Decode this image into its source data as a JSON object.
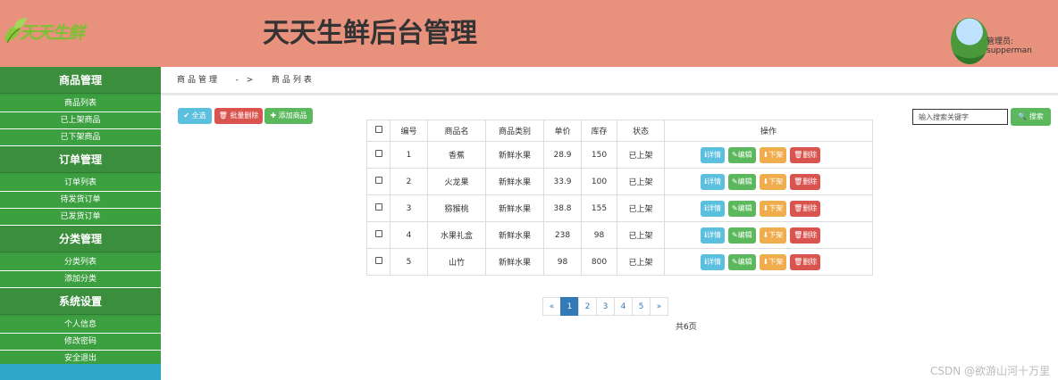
{
  "header": {
    "logo_text": "天天生鲜",
    "title": "天天生鲜后台管理",
    "admin_label": "管理员: supperman"
  },
  "sidebar": {
    "groups": [
      {
        "title": "商品管理",
        "items": [
          "商品列表",
          "已上架商品",
          "已下架商品"
        ]
      },
      {
        "title": "订单管理",
        "items": [
          "订单列表",
          "待发货订单",
          "已发货订单"
        ]
      },
      {
        "title": "分类管理",
        "items": [
          "分类列表",
          "添加分类"
        ]
      },
      {
        "title": "系统设置",
        "items": [
          "个人信息",
          "修改密码",
          "安全退出"
        ]
      }
    ]
  },
  "breadcrumb": {
    "section": "商品管理",
    "sep": "- >",
    "page": "商品列表"
  },
  "toolbar": {
    "select_all": "✔ 全选",
    "batch_delete": "🗑 批量删除",
    "add_product": "✚ 添加商品",
    "search_placeholder": "输入搜索关键字",
    "search_button": "🔍 搜索"
  },
  "table": {
    "headers": [
      "编号",
      "商品名",
      "商品类别",
      "单价",
      "库存",
      "状态",
      "操作"
    ],
    "rows": [
      {
        "id": "1",
        "name": "香蕉",
        "category": "新鲜水果",
        "price": "28.9",
        "stock": "150",
        "status": "已上架"
      },
      {
        "id": "2",
        "name": "火龙果",
        "category": "新鲜水果",
        "price": "33.9",
        "stock": "100",
        "status": "已上架"
      },
      {
        "id": "3",
        "name": "猕猴桃",
        "category": "新鲜水果",
        "price": "38.8",
        "stock": "155",
        "status": "已上架"
      },
      {
        "id": "4",
        "name": "水果礼盒",
        "category": "新鲜水果",
        "price": "238",
        "stock": "98",
        "status": "已上架"
      },
      {
        "id": "5",
        "name": "山竹",
        "category": "新鲜水果",
        "price": "98",
        "stock": "800",
        "status": "已上架"
      }
    ],
    "actions": {
      "detail": "ℹ详情",
      "edit": "✎编辑",
      "offshelf": "⬇下架",
      "delete": "🗑删除"
    }
  },
  "pagination": {
    "prev": "«",
    "pages": [
      "1",
      "2",
      "3",
      "4",
      "5"
    ],
    "next": "»",
    "active": "1",
    "total": "共6页"
  },
  "watermark": "CSDN @欲游山河十万里"
}
